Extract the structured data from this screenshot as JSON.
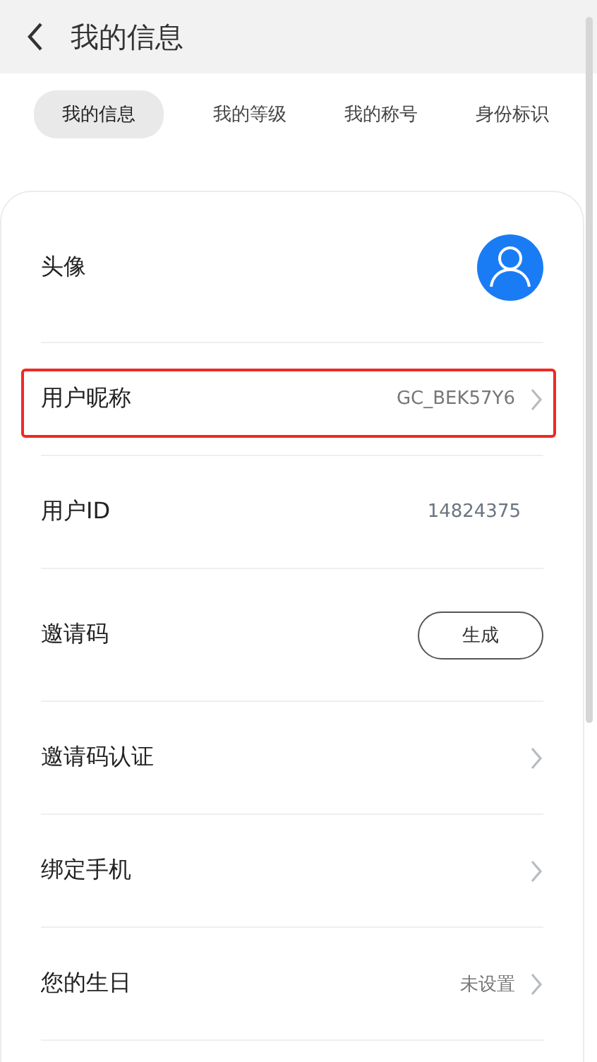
{
  "header": {
    "title": "我的信息"
  },
  "tabs": [
    {
      "label": "我的信息",
      "selected": true
    },
    {
      "label": "我的等级",
      "selected": false
    },
    {
      "label": "我的称号",
      "selected": false
    },
    {
      "label": "身份标识",
      "selected": false
    }
  ],
  "rows": [
    {
      "kind": "avatar",
      "label": "头像",
      "highlighted": false
    },
    {
      "kind": "link",
      "label": "用户昵称",
      "value": "GC_BEK57Y6",
      "highlighted": true
    },
    {
      "kind": "value",
      "label": "用户ID",
      "value": "14824375",
      "highlighted": false
    },
    {
      "kind": "button",
      "label": "邀请码",
      "button": "生成",
      "highlighted": false
    },
    {
      "kind": "link",
      "label": "邀请码认证",
      "highlighted": false
    },
    {
      "kind": "link",
      "label": "绑定手机",
      "highlighted": false
    },
    {
      "kind": "link",
      "label": "您的生日",
      "value": "未设置",
      "highlighted": false
    }
  ]
}
